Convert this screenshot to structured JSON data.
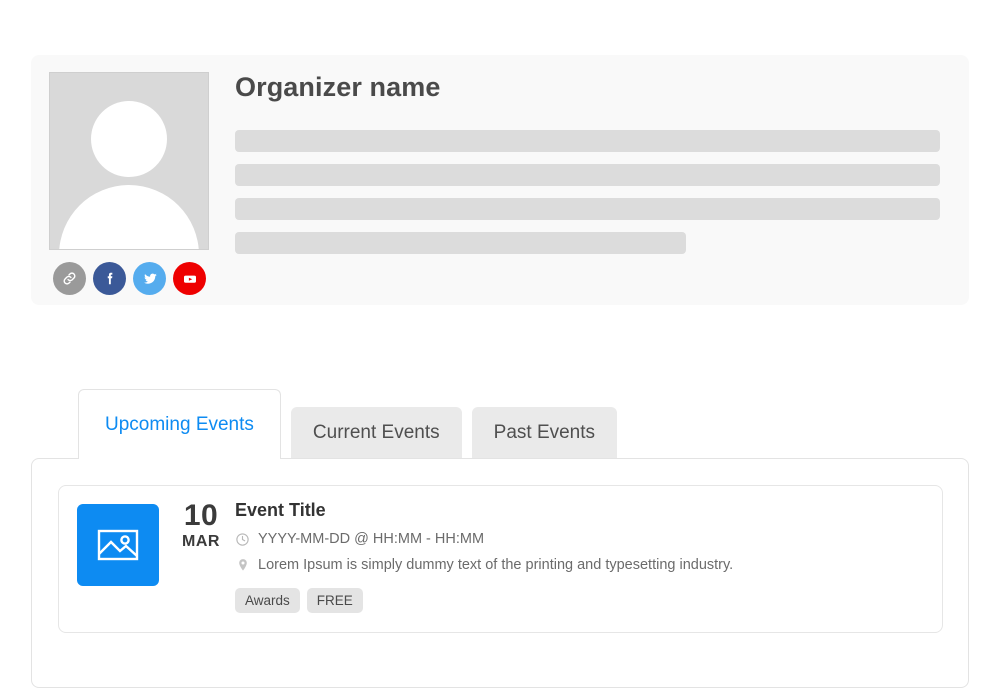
{
  "organizer": {
    "name": "Organizer name",
    "avatar_alt": "avatar-placeholder",
    "description_placeholder_lines": 4,
    "social_links": [
      {
        "name": "website-link",
        "label": "Website",
        "color": "#9a9a9a"
      },
      {
        "name": "facebook",
        "label": "Facebook",
        "color": "#3b5998"
      },
      {
        "name": "twitter",
        "label": "Twitter",
        "color": "#55acee"
      },
      {
        "name": "youtube",
        "label": "YouTube",
        "color": "#ee0000"
      }
    ]
  },
  "tabs": {
    "active_index": 0,
    "items": [
      {
        "label": "Upcoming Events",
        "active": true
      },
      {
        "label": "Current  Events",
        "active": false
      },
      {
        "label": "Past  Events",
        "active": false
      }
    ],
    "active_color": "#0d8bf2"
  },
  "events": [
    {
      "day": "10",
      "month": "MAR",
      "title": "Event Title",
      "datetime": "YYYY-MM-DD @ HH:MM - HH:MM",
      "location": "Lorem Ipsum is simply dummy text of the printing and typesetting industry.",
      "thumb_color": "#0d8bf2",
      "tags": [
        "Awards",
        "FREE"
      ]
    }
  ]
}
